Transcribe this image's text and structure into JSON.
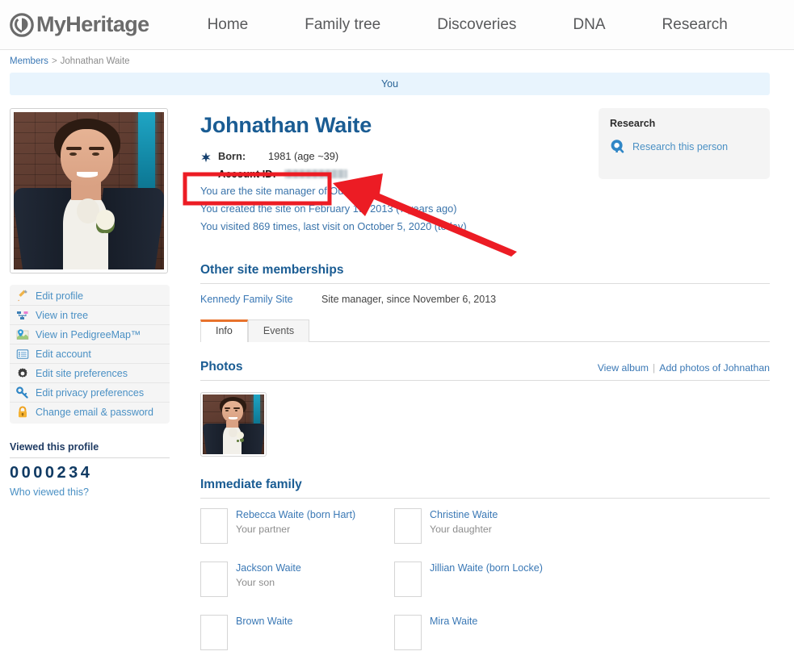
{
  "header": {
    "logo_text": "MyHeritage",
    "logo_icon": "myheritage-logo-icon",
    "nav": [
      {
        "label": "Home"
      },
      {
        "label": "Family tree"
      },
      {
        "label": "Discoveries"
      },
      {
        "label": "DNA"
      },
      {
        "label": "Research"
      }
    ]
  },
  "breadcrumb": {
    "root": "Members",
    "separator": ">",
    "current": "Johnathan Waite"
  },
  "banner": {
    "label": "You"
  },
  "left": {
    "photo_alt": "profile-photo",
    "links": [
      {
        "label": "Edit profile",
        "icon": "pencil-icon"
      },
      {
        "label": "View in tree",
        "icon": "tree-icon"
      },
      {
        "label": "View in PedigreeMap™",
        "icon": "map-pin-icon"
      },
      {
        "label": "Edit account",
        "icon": "list-icon"
      },
      {
        "label": "Edit site preferences",
        "icon": "gear-icon"
      },
      {
        "label": "Edit privacy preferences",
        "icon": "key-icon"
      },
      {
        "label": "Change email & password",
        "icon": "lock-icon"
      }
    ],
    "viewed": {
      "title": "Viewed this profile",
      "count": "0000234",
      "link": "Who viewed this?"
    }
  },
  "profile": {
    "name": "Johnathan Waite",
    "born_label": "Born:",
    "born_value": "1981 (age ~39)",
    "account_id_label": "Account ID:",
    "account_id_value": "",
    "lines": [
      "You are the site manager of Our family",
      "You created the site on February 19, 2013 (7 years ago)",
      "You visited 869 times, last visit on October 5, 2020 (today)"
    ]
  },
  "research_card": {
    "title": "Research",
    "link": "Research this person",
    "icon": "research-magnifier-icon"
  },
  "memberships": {
    "heading": "Other site memberships",
    "site": "Kennedy Family Site",
    "role": "Site manager, since November 6, 2013",
    "tabs": [
      {
        "label": "Info",
        "active": true
      },
      {
        "label": "Events",
        "active": false
      }
    ]
  },
  "photos": {
    "heading": "Photos",
    "view_album": "View album",
    "separator": "|",
    "add_photos": "Add photos of Johnathan"
  },
  "family": {
    "heading": "Immediate family",
    "members": [
      {
        "name": "Rebecca Waite (born Hart)",
        "relation": "Your partner",
        "avatar": "photo-rebecca"
      },
      {
        "name": "Christine Waite",
        "relation": "Your daughter",
        "avatar": "placeholder-female"
      },
      {
        "name": "Jackson Waite",
        "relation": "Your son",
        "avatar": "placeholder-male"
      },
      {
        "name": "Jillian Waite (born Locke)",
        "relation": "",
        "avatar": "photo-jillian"
      },
      {
        "name": "Brown Waite",
        "relation": "",
        "avatar": "placeholder-male"
      },
      {
        "name": "Mira Waite",
        "relation": "",
        "avatar": "placeholder-female"
      }
    ]
  },
  "annotation": {
    "highlight_color": "#ec1c24",
    "arrow_color": "#ec1c24",
    "target": "Account ID:"
  }
}
